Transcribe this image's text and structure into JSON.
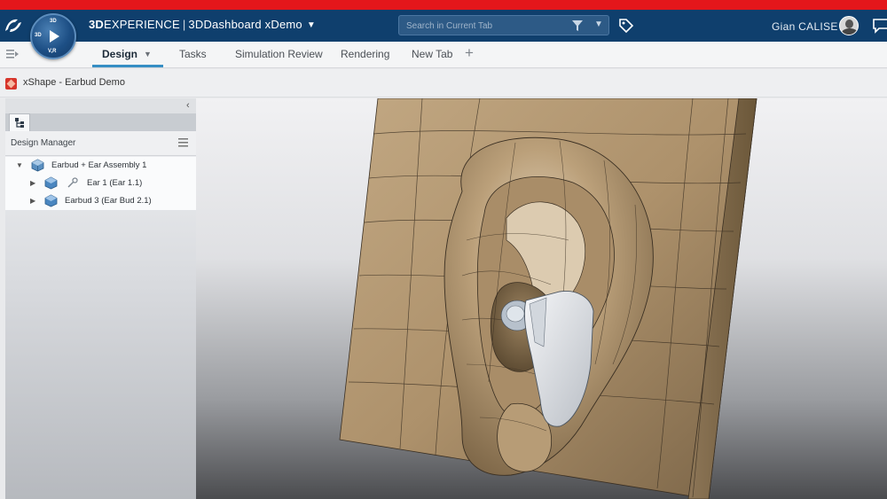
{
  "colors": {
    "accent_red": "#e4161b",
    "topbar": "#0f3f6d",
    "tab_underline": "#368ec4",
    "model_skin": "#b49a74",
    "earbud": "#e6e8eb"
  },
  "topbar": {
    "brand_left": "3D",
    "brand_right": "EXPERIENCE",
    "separator": "|",
    "app_name": "3DDashboard",
    "tenant": "xDemo",
    "search_placeholder": "Search in Current Tab",
    "user_name": "Gian CALISE",
    "compass_top": "3D",
    "compass_bottom": "V,R"
  },
  "tabs": [
    {
      "label": "Design",
      "active": true
    },
    {
      "label": "Tasks",
      "active": false
    },
    {
      "label": "Simulation Review",
      "active": false
    },
    {
      "label": "Rendering",
      "active": false
    },
    {
      "label": "New Tab",
      "active": false
    }
  ],
  "subbar": {
    "app_title": "xShape - Earbud Demo",
    "icon": "xshape-app-icon"
  },
  "design_manager": {
    "title": "Design Manager",
    "tree": [
      {
        "label": "Earbud + Ear Assembly 1",
        "expanded": true,
        "level": 0,
        "icon": "assembly-cube-icon"
      },
      {
        "label": "Ear 1 (Ear 1.1)",
        "expanded": false,
        "level": 1,
        "icon": "part-cube-icon"
      },
      {
        "label": "Earbud 3 (Ear Bud 2.1)",
        "expanded": false,
        "level": 1,
        "icon": "part-cube-icon"
      }
    ]
  },
  "icons": {
    "logo": "dassault-systemes-logo-icon",
    "compass": "compass-play-icon",
    "search_filter": "filter-icon",
    "tag": "tag-icon",
    "chat": "chat-icon",
    "panel_toggle": "panel-toggle-icon",
    "add_tab": "plus-icon",
    "tree_tab": "tree-structure-icon",
    "menu": "hamburger-menu-icon"
  }
}
